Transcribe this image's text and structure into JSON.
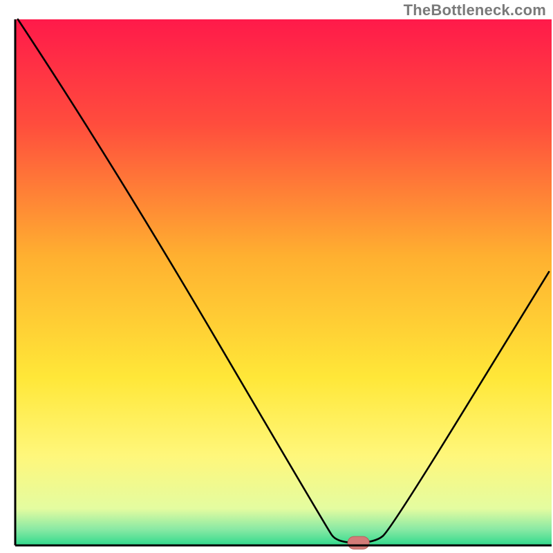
{
  "watermark": "TheBottleneck.com",
  "chart_data": {
    "type": "line",
    "title": "",
    "xlabel": "",
    "ylabel": "",
    "xlim": [
      0,
      100
    ],
    "ylim": [
      0,
      100
    ],
    "grid": false,
    "background_gradient": {
      "stops": [
        {
          "y_pct": 0,
          "color": "#ff1a4a"
        },
        {
          "y_pct": 20,
          "color": "#ff4d3d"
        },
        {
          "y_pct": 45,
          "color": "#ffb030"
        },
        {
          "y_pct": 68,
          "color": "#ffe738"
        },
        {
          "y_pct": 83,
          "color": "#fff77b"
        },
        {
          "y_pct": 93,
          "color": "#e4fca0"
        },
        {
          "y_pct": 97,
          "color": "#88e9a4"
        },
        {
          "y_pct": 100,
          "color": "#2fd98c"
        }
      ]
    },
    "series": [
      {
        "name": "bottleneck-curve",
        "color": "#000000",
        "points": [
          {
            "x": 0.5,
            "y": 100.0
          },
          {
            "x": 18.0,
            "y": 73.0
          },
          {
            "x": 58.0,
            "y": 3.5
          },
          {
            "x": 60.0,
            "y": 0.5
          },
          {
            "x": 67.0,
            "y": 0.5
          },
          {
            "x": 70.0,
            "y": 3.0
          },
          {
            "x": 99.5,
            "y": 52.0
          }
        ]
      }
    ],
    "markers": [
      {
        "name": "optimal-marker",
        "shape": "rounded-capsule",
        "x": 64.0,
        "y": 0.5,
        "width_pct": 4.0,
        "height_pct": 2.4,
        "fill": "#d37b78",
        "stroke": "#b95f5d"
      }
    ],
    "axes": {
      "left": {
        "color": "#000000",
        "width": 3
      },
      "bottom": {
        "color": "#000000",
        "width": 3
      }
    }
  }
}
